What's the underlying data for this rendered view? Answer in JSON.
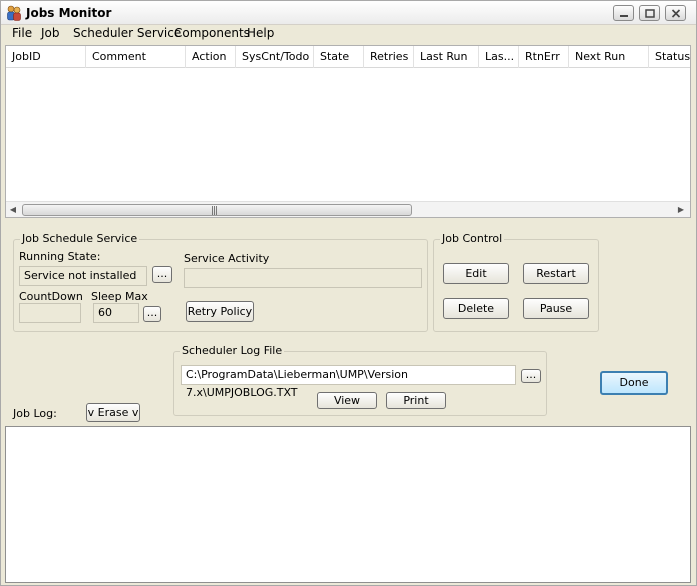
{
  "window": {
    "title": "Jobs Monitor"
  },
  "menu": [
    "File",
    "Job",
    "Scheduler Service",
    "Components",
    "Help"
  ],
  "grid": {
    "columns": [
      "JobID",
      "Comment",
      "Action",
      "SysCnt/Todo",
      "State",
      "Retries",
      "Last Run",
      "Las...",
      "RtnErr",
      "Next Run",
      "Status"
    ],
    "rows": []
  },
  "job_schedule_service": {
    "title": "Job Schedule Service",
    "running_state_label": "Running State:",
    "running_state_value": "Service not installed",
    "service_activity_label": "Service Activity",
    "service_activity_value": "",
    "countdown_label": "CountDown",
    "countdown_value": "",
    "sleep_max_label": "Sleep Max",
    "sleep_max_value": "60",
    "browse_label": "...",
    "retry_policy_label": "Retry Policy"
  },
  "job_control": {
    "title": "Job Control",
    "edit_label": "Edit",
    "restart_label": "Restart",
    "delete_label": "Delete",
    "pause_label": "Pause"
  },
  "scheduler_log": {
    "title": "Scheduler Log File",
    "path": "C:\\ProgramData\\Lieberman\\UMP\\Version 7.x\\UMPJOBLOG.TXT",
    "browse_label": "...",
    "view_label": "View",
    "print_label": "Print"
  },
  "job_log": {
    "label": "Job Log:",
    "erase_label": "v Erase v"
  },
  "done_label": "Done",
  "colors": {
    "window_bg": "#ece9d8",
    "done_border": "#3c7fb1"
  }
}
